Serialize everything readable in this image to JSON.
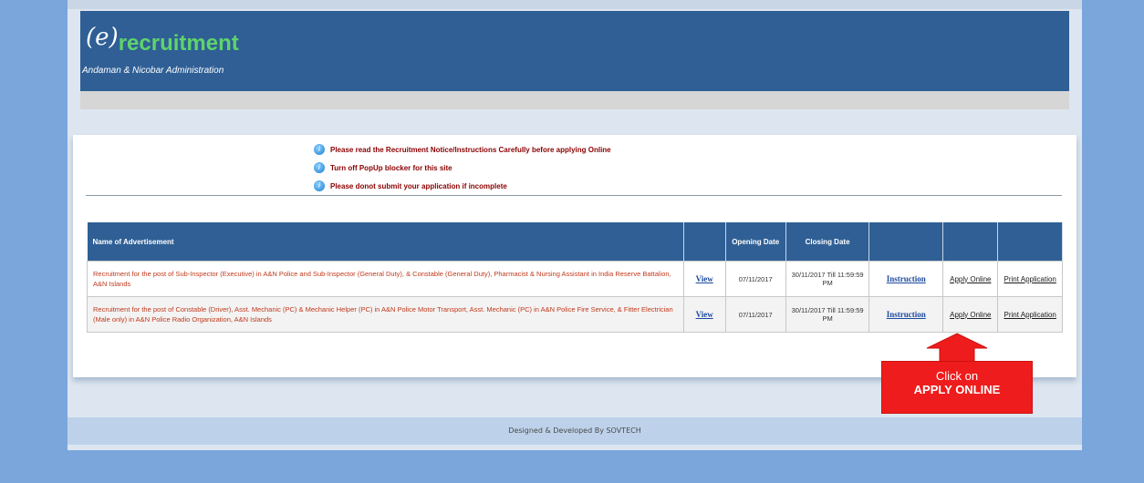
{
  "header": {
    "logo_e": "(e)",
    "logo_word": "recruitment",
    "subtitle": "Andaman & Nicobar Administration"
  },
  "notices": [
    "Please read the Recruitment Notice/Instructions Carefully before applying Online",
    "Turn off PopUp blocker for this site",
    "Please donot submit your application if incomplete"
  ],
  "table": {
    "headers": {
      "name": "Name of Advertisement",
      "opening": "Opening Date",
      "closing": "Closing Date"
    },
    "rows": [
      {
        "description": "Recruitment for the post of Sub-Inspector (Executive) in A&N Police and Sub-Inspector (General Duty), & Constable (General Duty), Pharmacist & Nursing Assistant in India Reserve Battalion, A&N Islands",
        "view": "View",
        "opening": "07/11/2017",
        "closing": "30/11/2017 Till 11:59:59 PM",
        "instruction": "Instruction",
        "apply": "Apply Online",
        "print": "Print Application"
      },
      {
        "description": "Recruitment for the post of Constable (Driver), Asst. Mechanic (PC) & Mechanic Helper (PC) in A&N Police Motor Transport, Asst. Mechanic (PC) in A&N Police Fire Service, & Fitter Electrician (Male only) in A&N Police Radio Organization, A&N Islands",
        "view": "View",
        "opening": "07/11/2017",
        "closing": "30/11/2017 Till 11:59:59 PM",
        "instruction": "Instruction",
        "apply": "Apply Online",
        "print": "Print Application"
      }
    ]
  },
  "callout": {
    "line1": "Click on",
    "line2": "APPLY ONLINE"
  },
  "footer": "Designed & Developed By SOVTECH",
  "colors": {
    "banner": "#2f5f95",
    "callout": "#ee1c1c",
    "desc_text": "#c0391b"
  }
}
